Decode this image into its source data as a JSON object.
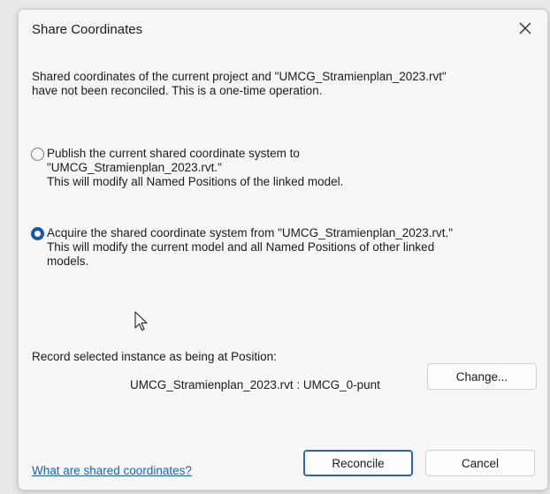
{
  "dialog": {
    "title": "Share Coordinates",
    "intro_lines": [
      "Shared coordinates of the current project and \"UMCG_Stramienplan_2023.rvt\"",
      "have not been reconciled. This is a one-time operation."
    ]
  },
  "options": [
    {
      "selected": false,
      "lines": [
        "Publish the current shared coordinate system to",
        "\"UMCG_Stramienplan_2023.rvt.\"",
        "This will modify all Named Positions of the linked model."
      ]
    },
    {
      "selected": true,
      "lines": [
        "Acquire the shared coordinate system from \"UMCG_Stramienplan_2023.rvt.\"",
        "This will modify the current model and all Named Positions of other linked",
        "models."
      ]
    }
  ],
  "position": {
    "label": "Record selected instance as being at Position:",
    "value": "UMCG_Stramienplan_2023.rvt : UMCG_0-punt",
    "change_button": "Change..."
  },
  "footer": {
    "help_link": "What are shared coordinates?",
    "reconcile_button": "Reconcile",
    "cancel_button": "Cancel"
  },
  "colors": {
    "accent": "#1a56b0",
    "link": "#1d5fb8"
  },
  "icons": {
    "close": "close-icon",
    "cursor": "mouse-pointer-icon"
  }
}
